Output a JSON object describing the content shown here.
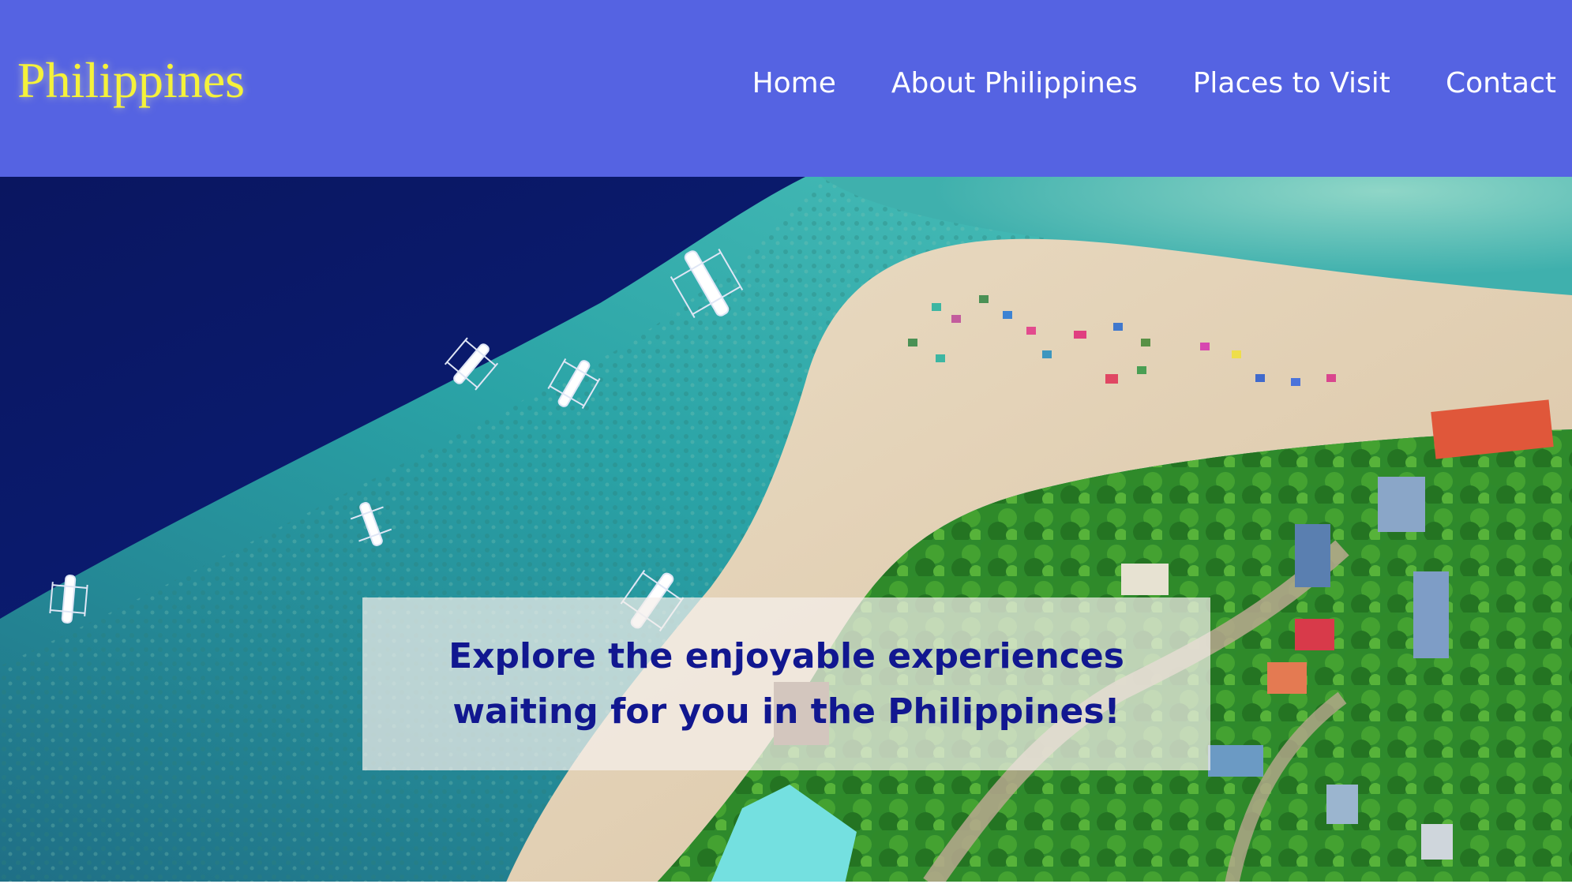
{
  "header": {
    "logo": "Philippines",
    "nav": [
      {
        "label": "Home"
      },
      {
        "label": "About Philippines"
      },
      {
        "label": "Places to Visit"
      },
      {
        "label": "Contact"
      }
    ]
  },
  "hero": {
    "headline": "Explore the enjoyable experiences waiting for you in the Philippines!",
    "image_description": "aerial-beach-island"
  },
  "colors": {
    "header_bg": "#5563e2",
    "logo": "#f5f23a",
    "nav_text": "#ffffff",
    "headline": "#111790"
  }
}
